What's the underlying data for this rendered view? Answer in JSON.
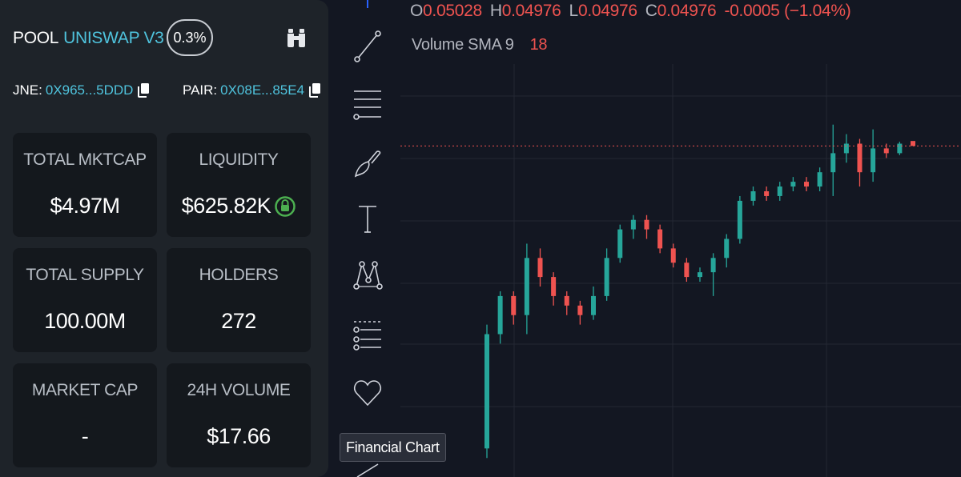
{
  "pool": {
    "label": "POOL",
    "name": "UNISWAP V3",
    "fee": "0.3%",
    "token_label": "JNE:",
    "token_addr": "0X965...5DDD",
    "pair_label": "PAIR:",
    "pair_addr": "0X08E...85E4"
  },
  "stats": {
    "total_mktcap_label": "TOTAL MKTCAP",
    "total_mktcap_value": "$4.97M",
    "liquidity_label": "LIQUIDITY",
    "liquidity_value": "$625.82K",
    "total_supply_label": "TOTAL SUPPLY",
    "total_supply_value": "100.00M",
    "holders_label": "HOLDERS",
    "holders_value": "272",
    "market_cap_label": "MARKET CAP",
    "market_cap_value": "-",
    "volume_label": "24H VOLUME",
    "volume_value": "$17.66"
  },
  "legend": {
    "o_key": "O",
    "o_val": "0.05028",
    "h_key": "H",
    "h_val": "0.04976",
    "l_key": "L",
    "l_val": "0.04976",
    "c_key": "C",
    "c_val": "0.04976",
    "change": "-0.0005 (−1.04%)",
    "vol_label": "Volume SMA 9",
    "vol_value": "18"
  },
  "tooltip": "Financial Chart",
  "icons": [
    "trend-line-icon",
    "fib-retracement-icon",
    "brush-icon",
    "text-icon",
    "pattern-icon",
    "prediction-icon",
    "favorites-heart-icon"
  ],
  "colors": {
    "accent": "#4fc3dd",
    "up": "#26a69a",
    "down": "#ef5350",
    "lock": "#4caf50"
  },
  "chart_data": {
    "type": "candlestick",
    "price_line": "dotted red line at last close",
    "candles": [
      {
        "o": 0.018,
        "c": 0.03,
        "h": 0.031,
        "l": 0.017
      },
      {
        "o": 0.03,
        "c": 0.034,
        "h": 0.0345,
        "l": 0.029
      },
      {
        "o": 0.034,
        "c": 0.032,
        "h": 0.0345,
        "l": 0.031
      },
      {
        "o": 0.032,
        "c": 0.038,
        "h": 0.0395,
        "l": 0.03
      },
      {
        "o": 0.038,
        "c": 0.036,
        "h": 0.039,
        "l": 0.035
      },
      {
        "o": 0.036,
        "c": 0.034,
        "h": 0.0365,
        "l": 0.033
      },
      {
        "o": 0.034,
        "c": 0.033,
        "h": 0.0345,
        "l": 0.032
      },
      {
        "o": 0.033,
        "c": 0.032,
        "h": 0.0335,
        "l": 0.031
      },
      {
        "o": 0.032,
        "c": 0.034,
        "h": 0.035,
        "l": 0.0315
      },
      {
        "o": 0.034,
        "c": 0.038,
        "h": 0.039,
        "l": 0.0335
      },
      {
        "o": 0.038,
        "c": 0.041,
        "h": 0.0415,
        "l": 0.0375
      },
      {
        "o": 0.041,
        "c": 0.042,
        "h": 0.0425,
        "l": 0.04
      },
      {
        "o": 0.042,
        "c": 0.041,
        "h": 0.0425,
        "l": 0.04
      },
      {
        "o": 0.041,
        "c": 0.039,
        "h": 0.0415,
        "l": 0.0385
      },
      {
        "o": 0.039,
        "c": 0.0375,
        "h": 0.0395,
        "l": 0.037
      },
      {
        "o": 0.0375,
        "c": 0.036,
        "h": 0.038,
        "l": 0.0355
      },
      {
        "o": 0.036,
        "c": 0.0365,
        "h": 0.037,
        "l": 0.0355
      },
      {
        "o": 0.0365,
        "c": 0.038,
        "h": 0.0385,
        "l": 0.034
      },
      {
        "o": 0.038,
        "c": 0.04,
        "h": 0.0405,
        "l": 0.037
      },
      {
        "o": 0.04,
        "c": 0.044,
        "h": 0.0445,
        "l": 0.0395
      },
      {
        "o": 0.044,
        "c": 0.045,
        "h": 0.0455,
        "l": 0.0435
      },
      {
        "o": 0.045,
        "c": 0.0445,
        "h": 0.0455,
        "l": 0.044
      },
      {
        "o": 0.0445,
        "c": 0.0455,
        "h": 0.046,
        "l": 0.044
      },
      {
        "o": 0.0455,
        "c": 0.046,
        "h": 0.0465,
        "l": 0.045
      },
      {
        "o": 0.046,
        "c": 0.0455,
        "h": 0.0465,
        "l": 0.045
      },
      {
        "o": 0.0455,
        "c": 0.047,
        "h": 0.0475,
        "l": 0.045
      },
      {
        "o": 0.047,
        "c": 0.049,
        "h": 0.052,
        "l": 0.0445
      },
      {
        "o": 0.049,
        "c": 0.05,
        "h": 0.051,
        "l": 0.048
      },
      {
        "o": 0.05,
        "c": 0.047,
        "h": 0.0505,
        "l": 0.0455
      },
      {
        "o": 0.047,
        "c": 0.0495,
        "h": 0.0515,
        "l": 0.046
      },
      {
        "o": 0.0495,
        "c": 0.049,
        "h": 0.05,
        "l": 0.0485
      },
      {
        "o": 0.049,
        "c": 0.05,
        "h": 0.0502,
        "l": 0.0488
      },
      {
        "o": 0.05028,
        "c": 0.04976,
        "h": 0.04976,
        "l": 0.04976
      }
    ]
  }
}
